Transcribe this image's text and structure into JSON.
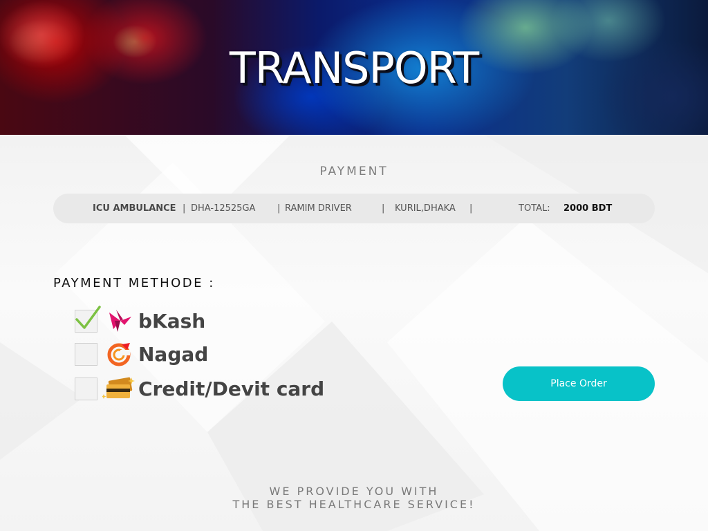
{
  "header": {
    "title": "TRANSPORT"
  },
  "payment": {
    "title": "PAYMENT",
    "vehicle": "ICU AMBULANCE",
    "sep1": "|",
    "plate": "DHA-12525GA",
    "sep2": "|",
    "driver": "RAMIM DRIVER",
    "sep3": "|",
    "location": "KURIL,DHAKA",
    "sep4": "|",
    "total_label": "TOTAL:",
    "total_value": "2000 BDT"
  },
  "methods": {
    "label": "PAYMENT METHODE :",
    "options": [
      {
        "label": "bKash",
        "checked": true,
        "icon": "bkash-bird-icon"
      },
      {
        "label": "Nagad",
        "checked": false,
        "icon": "nagad-logo-icon"
      },
      {
        "label": "Credit/Devit card",
        "checked": false,
        "icon": "credit-card-icon"
      }
    ]
  },
  "actions": {
    "place_order": "Place Order"
  },
  "footer": {
    "line1": "WE PROVIDE YOU WITH",
    "line2": "THE BEST HEALTHCARE SERVICE!"
  },
  "colors": {
    "accent": "#08c2c8",
    "check": "#7cc142",
    "bkash": "#e2136e",
    "nagad": "#f26522",
    "card": "#e8a533"
  }
}
